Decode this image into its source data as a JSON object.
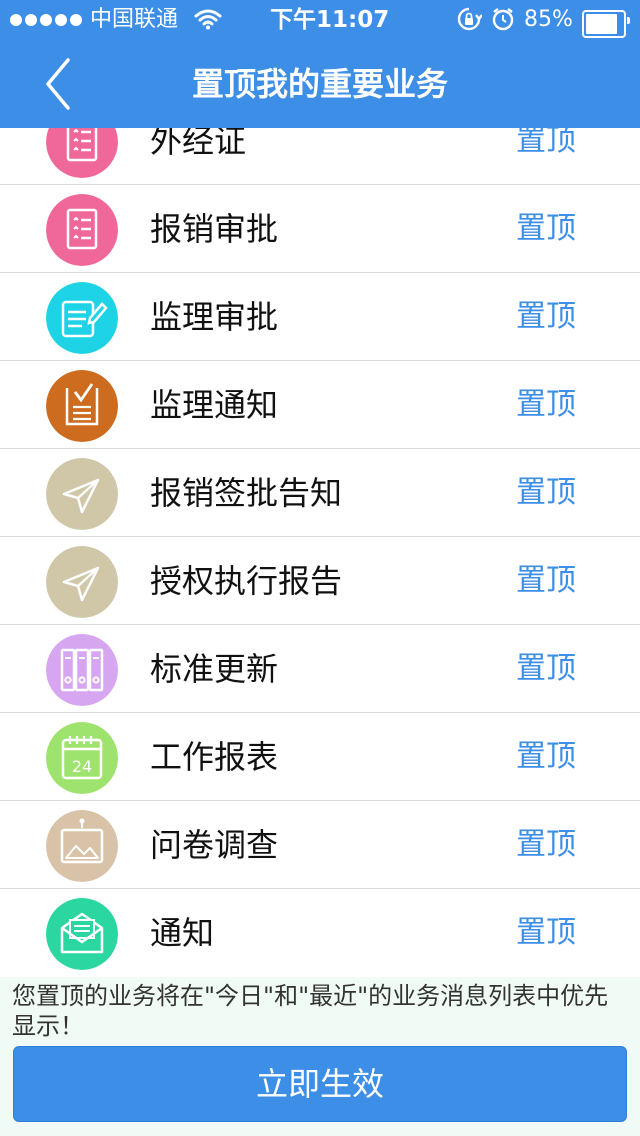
{
  "status_bar": {
    "carrier": "中国联通",
    "time": "下午11:07",
    "battery": "85%",
    "battery_level": 0.85
  },
  "nav": {
    "title": "置顶我的重要业务"
  },
  "list": {
    "items": [
      {
        "label": "外经证",
        "action": "置顶",
        "icon": "list-doc-icon",
        "color": "#f0679a"
      },
      {
        "label": "报销审批",
        "action": "置顶",
        "icon": "list-doc-icon",
        "color": "#f0679a"
      },
      {
        "label": "监理审批",
        "action": "置顶",
        "icon": "edit-document-icon",
        "color": "#1fd3e6"
      },
      {
        "label": "监理通知",
        "action": "置顶",
        "icon": "checklist-icon",
        "color": "#cd6b1f"
      },
      {
        "label": "报销签批告知",
        "action": "置顶",
        "icon": "paper-plane-icon",
        "color": "#cfc7a8"
      },
      {
        "label": "授权执行报告",
        "action": "置顶",
        "icon": "paper-plane-icon",
        "color": "#cfc7a8"
      },
      {
        "label": "标准更新",
        "action": "置顶",
        "icon": "binders-icon",
        "color": "#d7a6f1"
      },
      {
        "label": "工作报表",
        "action": "置顶",
        "icon": "calendar-icon",
        "color": "#9fe36f",
        "badge": "24"
      },
      {
        "label": "问卷调查",
        "action": "置顶",
        "icon": "picture-icon",
        "color": "#d9c3a8"
      },
      {
        "label": "通知",
        "action": "置顶",
        "icon": "envelope-icon",
        "color": "#2bd6a1"
      }
    ]
  },
  "footer": {
    "note": "您置顶的业务将在\"今日\"和\"最近\"的业务消息列表中优先显示！",
    "button": "立即生效"
  }
}
